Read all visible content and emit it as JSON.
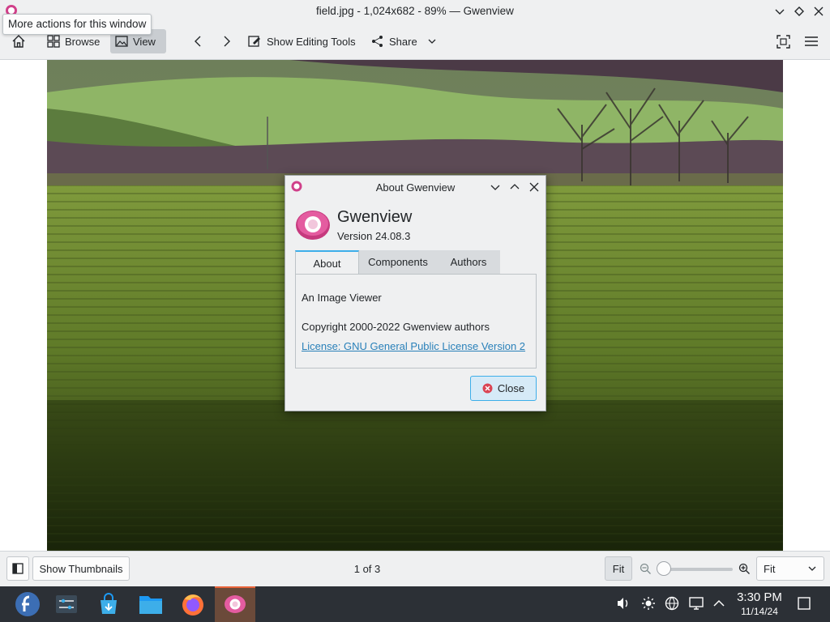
{
  "window": {
    "title": "field.jpg - 1,024x682 - 89% — Gwenview",
    "tooltip": "More actions for this window"
  },
  "toolbar": {
    "browse_label": "Browse",
    "view_label": "View",
    "editing_label": "Show Editing Tools",
    "share_label": "Share"
  },
  "statusbar": {
    "thumbnails_label": "Show Thumbnails",
    "page_count": "1 of 3",
    "fit_label": "Fit",
    "zoom_select_value": "Fit",
    "zoom_slider_level": 0.0
  },
  "dialog": {
    "title": "About Gwenview",
    "app_name": "Gwenview",
    "version": "Version 24.08.3",
    "tabs": [
      {
        "label": "About"
      },
      {
        "label": "Components"
      },
      {
        "label": "Authors"
      }
    ],
    "description": "An Image Viewer",
    "copyright": "Copyright 2000-2022 Gwenview authors",
    "license": "License: GNU General Public License Version 2",
    "close_label": "Close"
  },
  "taskbar": {
    "time": "3:30 PM",
    "date": "11/14/24",
    "apps": [
      "fedora-icon",
      "system-settings-icon",
      "discover-store-icon",
      "dolphin-files-icon",
      "firefox-icon",
      "gwenview-icon"
    ]
  },
  "colors": {
    "accent": "#3daee9",
    "gwenview_pink": "#d0408a",
    "taskbar_bg": "#2c3036",
    "active_task": "#e9643a"
  }
}
